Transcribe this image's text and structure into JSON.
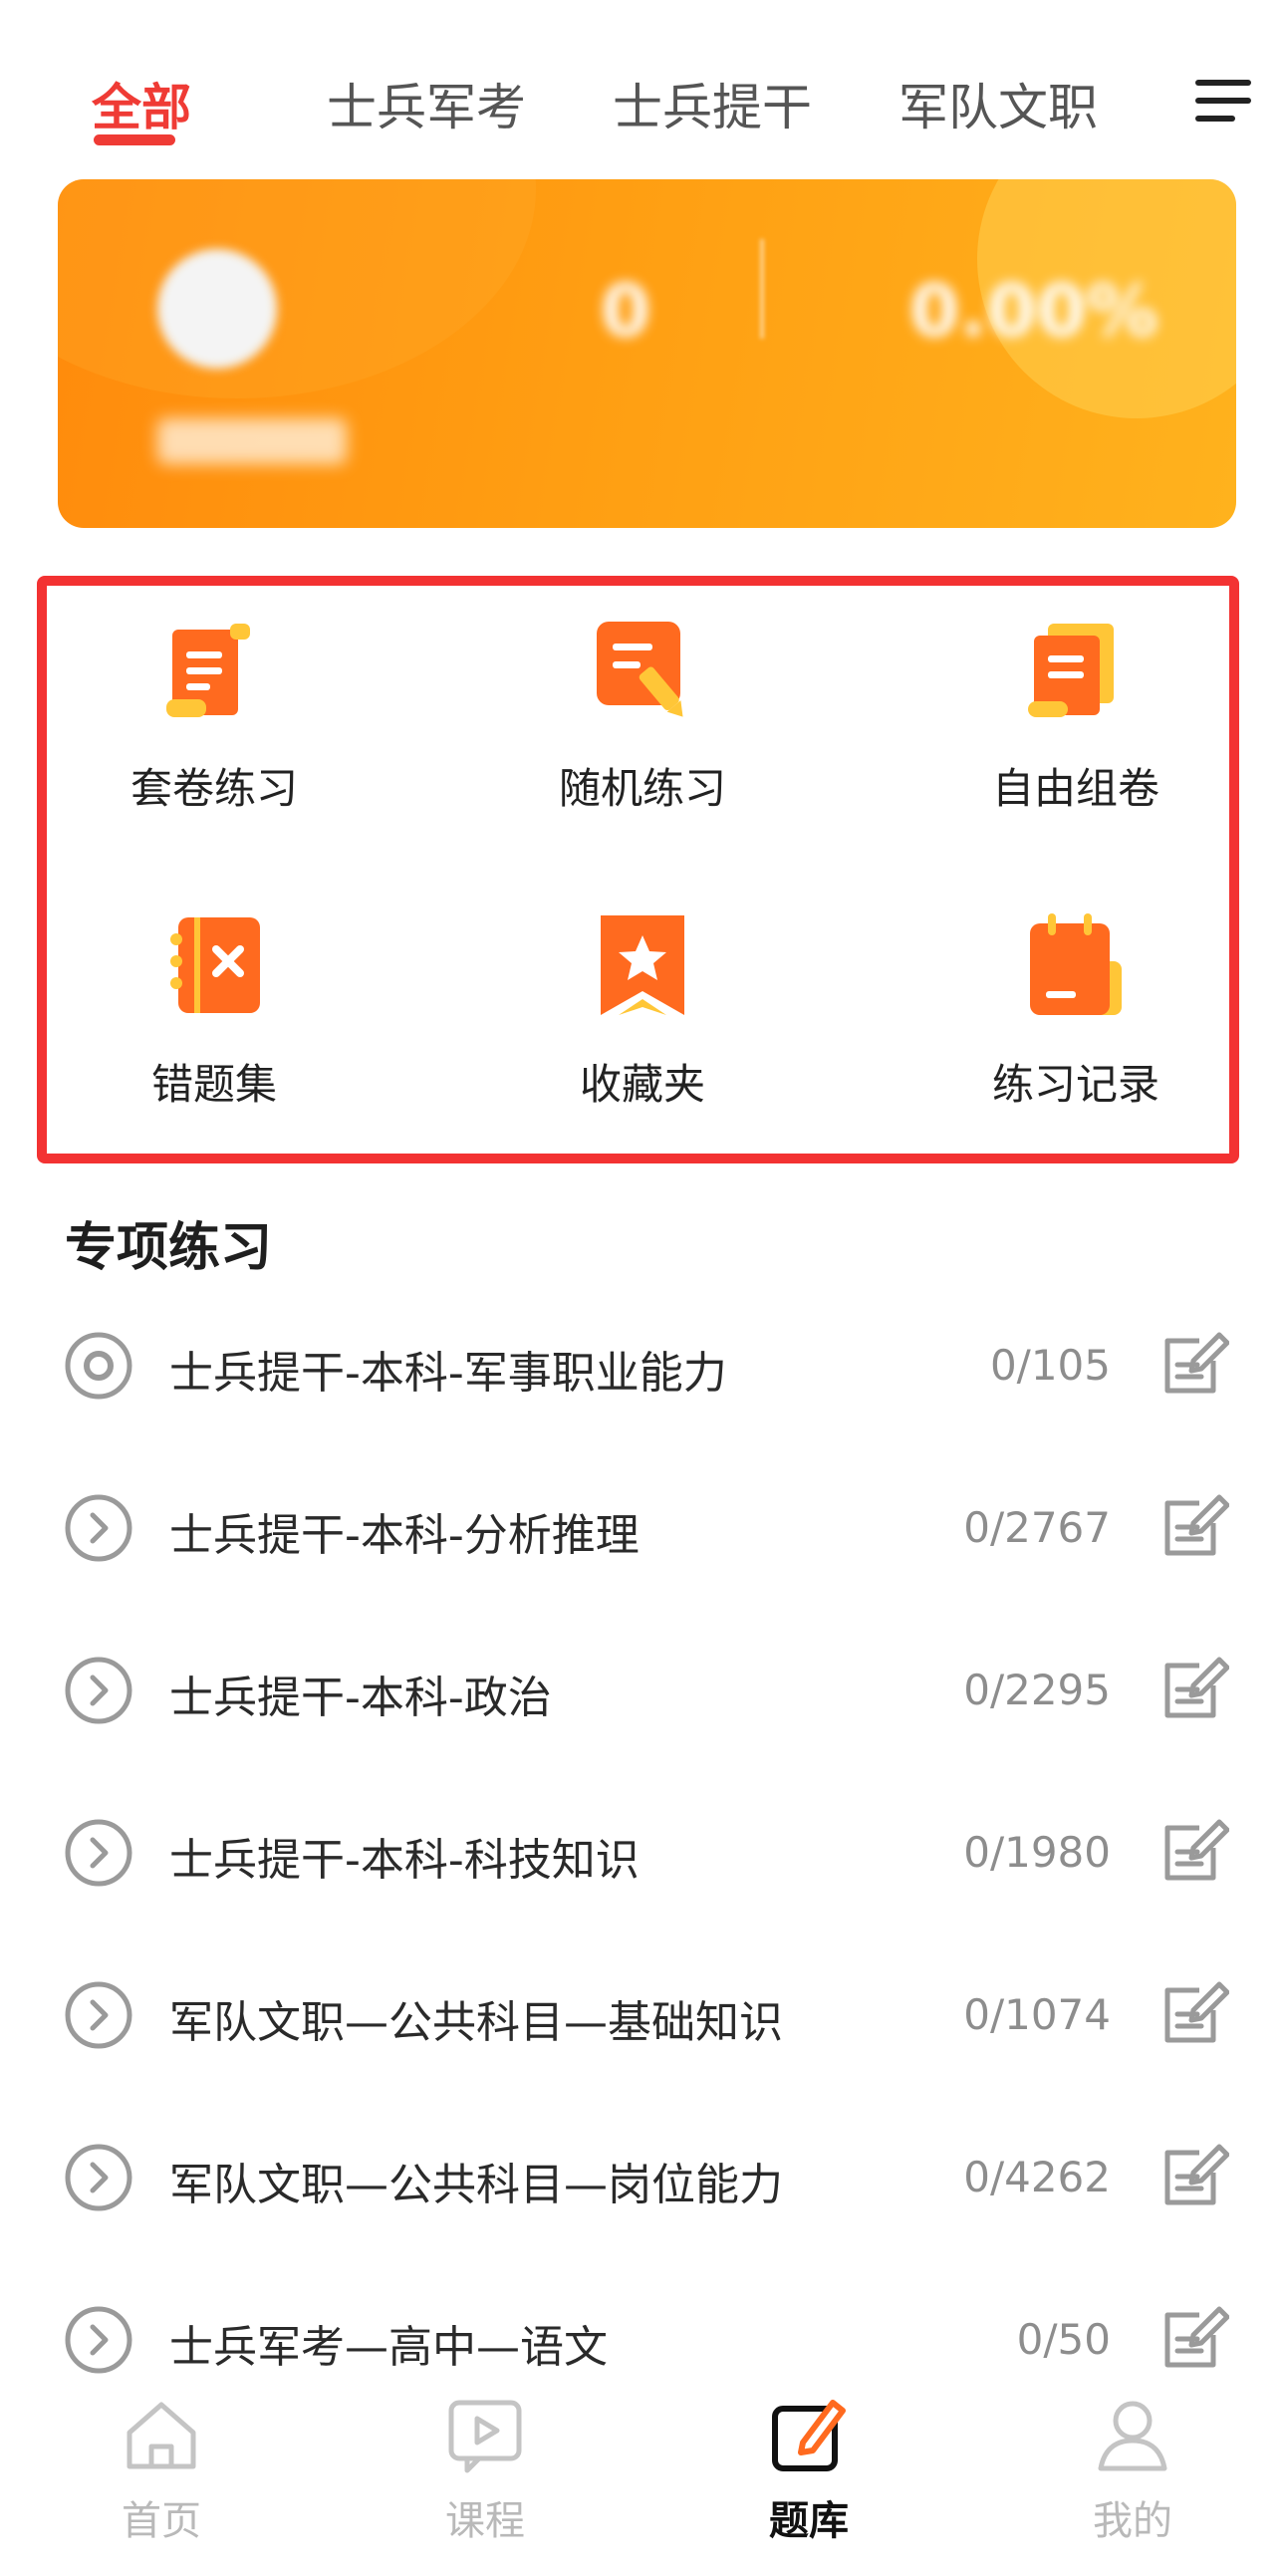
{
  "tabs": [
    {
      "label": "全部",
      "active": true
    },
    {
      "label": "士兵军考",
      "active": false
    },
    {
      "label": "士兵提干",
      "active": false
    },
    {
      "label": "军队文职",
      "active": false
    }
  ],
  "icons": {
    "menu": "hamburger-menu-icon"
  },
  "banner": {
    "stats": [
      {
        "value": "",
        "label": ""
      },
      {
        "value": "0",
        "label": ""
      },
      {
        "value": "0.00%",
        "label": ""
      }
    ],
    "note": ""
  },
  "features": [
    {
      "label": "套卷练习",
      "icon": "scroll-paper-icon"
    },
    {
      "label": "随机练习",
      "icon": "note-pencil-icon"
    },
    {
      "label": "自由组卷",
      "icon": "stacked-papers-icon"
    },
    {
      "label": "错题集",
      "icon": "wrong-notebook-icon"
    },
    {
      "label": "收藏夹",
      "icon": "bookmark-star-icon"
    },
    {
      "label": "练习记录",
      "icon": "calendar-record-icon"
    }
  ],
  "section": {
    "title": "专项练习"
  },
  "practice_list": [
    {
      "label": "士兵提干-本科-军事职业能力",
      "count": "0/105",
      "icon": "target-circle-icon"
    },
    {
      "label": "士兵提干-本科-分析推理",
      "count": "0/2767",
      "icon": "chevron-circle-icon"
    },
    {
      "label": "士兵提干-本科-政治",
      "count": "0/2295",
      "icon": "chevron-circle-icon"
    },
    {
      "label": "士兵提干-本科-科技知识",
      "count": "0/1980",
      "icon": "chevron-circle-icon"
    },
    {
      "label": "军队文职—公共科目—基础知识",
      "count": "0/1074",
      "icon": "chevron-circle-icon"
    },
    {
      "label": "军队文职—公共科目—岗位能力",
      "count": "0/4262",
      "icon": "chevron-circle-icon"
    },
    {
      "label": "士兵军考—高中—语文",
      "count": "0/50",
      "icon": "chevron-circle-icon"
    }
  ],
  "bottom_nav": [
    {
      "label": "首页",
      "icon": "home-icon",
      "active": false
    },
    {
      "label": "课程",
      "icon": "course-play-icon",
      "active": false
    },
    {
      "label": "题库",
      "icon": "question-bank-edit-icon",
      "active": true
    },
    {
      "label": "我的",
      "icon": "profile-icon",
      "active": false
    }
  ],
  "colors": {
    "accent": "#ef3b35",
    "icon_orange": "#ff6a1f",
    "icon_yellow": "#ffc637",
    "highlight_border": "#f33232",
    "banner_start": "#ff8b0c",
    "banner_end": "#ffb21d"
  }
}
